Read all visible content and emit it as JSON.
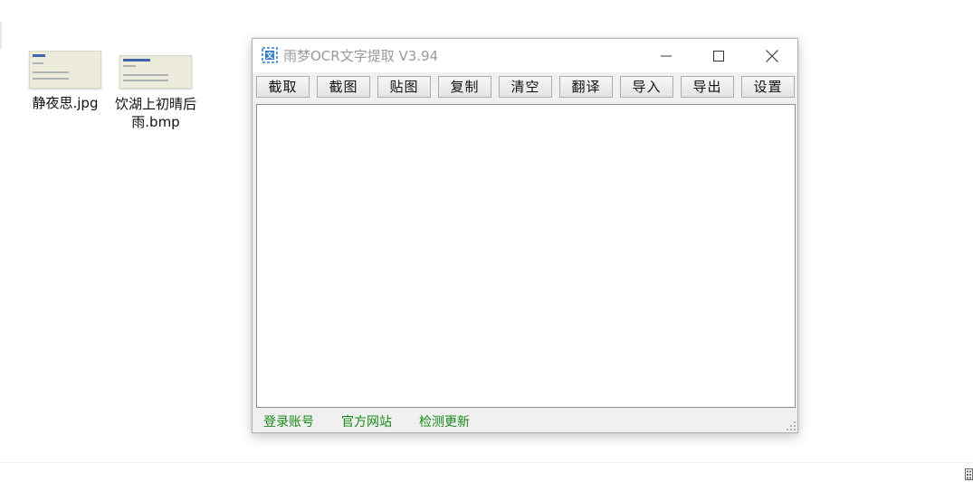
{
  "desktop": {
    "files": [
      {
        "name": "静夜思.jpg",
        "thumb_icon": "image-file-thumbnail-icon"
      },
      {
        "name": "饮湖上初晴后雨.bmp",
        "thumb_icon": "image-file-thumbnail-icon"
      }
    ]
  },
  "window": {
    "title": "雨梦OCR文字提取 V3.94",
    "app_icon": "ocr-scan-icon",
    "controls": {
      "minimize": "minimize-icon",
      "maximize": "maximize-icon",
      "close": "close-icon"
    },
    "toolbar": [
      "截取",
      "截图",
      "贴图",
      "复制",
      "清空",
      "翻译",
      "导入",
      "导出",
      "设置"
    ],
    "text_area_value": "",
    "footer_links": [
      "登录账号",
      "官方网站",
      "检测更新"
    ]
  },
  "colors": {
    "link": "#188a18",
    "title_text": "#9a9a9a",
    "app_icon_blue": "#2f7fd0",
    "thumb_background": "#ecebdc"
  }
}
